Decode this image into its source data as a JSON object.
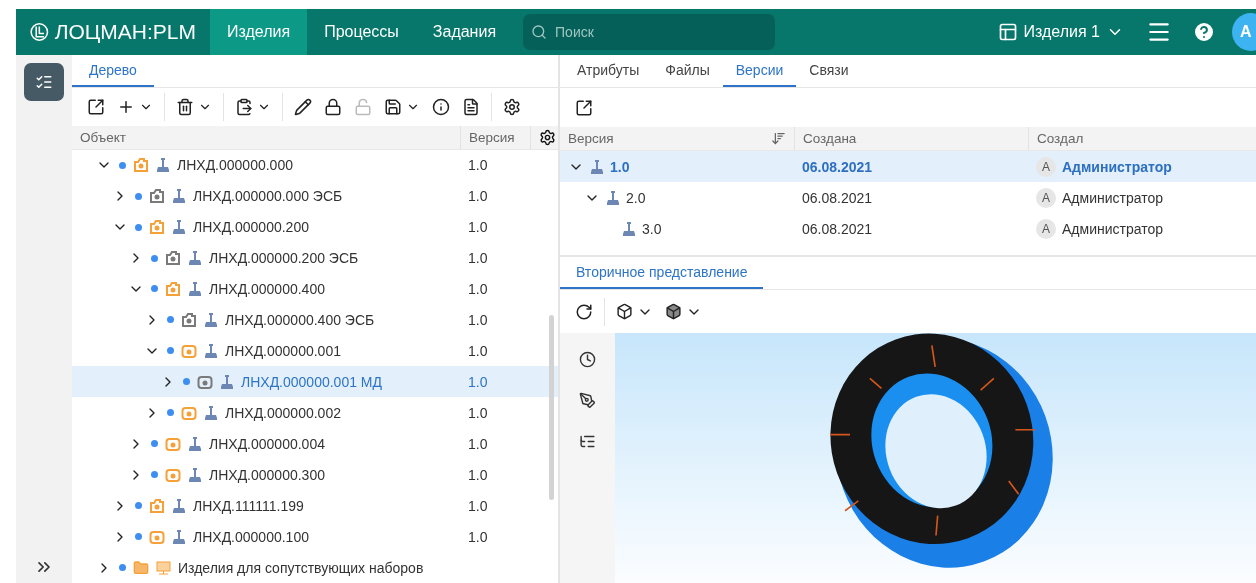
{
  "header": {
    "logo": "ЛОЦМАН:PLM",
    "nav": [
      {
        "label": "Изделия",
        "selected": true
      },
      {
        "label": "Процессы",
        "selected": false
      },
      {
        "label": "Задания",
        "selected": false
      }
    ],
    "search": {
      "placeholder": "Поиск"
    },
    "workspace": "Изделия 1",
    "avatar": "А"
  },
  "left_panel": {
    "tabs": [
      {
        "label": "Дерево",
        "selected": true
      }
    ],
    "toolbar": [
      {
        "kind": "export",
        "disabled": false,
        "menu": false
      },
      {
        "kind": "add",
        "disabled": false,
        "menu": true
      },
      {
        "kind": "divider"
      },
      {
        "kind": "delete",
        "disabled": false,
        "menu": true
      },
      {
        "kind": "divider"
      },
      {
        "kind": "paste",
        "disabled": false,
        "menu": true
      },
      {
        "kind": "divider"
      },
      {
        "kind": "edit",
        "disabled": false,
        "menu": false
      },
      {
        "kind": "lock",
        "disabled": false,
        "menu": false
      },
      {
        "kind": "unlock",
        "disabled": true,
        "menu": false
      },
      {
        "kind": "save",
        "disabled": false,
        "menu": true
      },
      {
        "kind": "info",
        "disabled": false,
        "menu": false
      },
      {
        "kind": "report",
        "disabled": false,
        "menu": false
      },
      {
        "kind": "divider"
      },
      {
        "kind": "settings",
        "disabled": false,
        "menu": false
      }
    ],
    "columns": [
      "Объект",
      "Версия"
    ],
    "rows": [
      {
        "label": "ЛНХД.000000.000",
        "version": "1.0",
        "kind": "assembly",
        "expanded": true,
        "selected": false,
        "children": [
          {
            "label": "ЛНХД.000000.000 ЭСБ",
            "version": "1.0",
            "kind": "esb",
            "expanded": false,
            "selected": false
          },
          {
            "label": "ЛНХД.000000.200",
            "version": "1.0",
            "kind": "assembly",
            "expanded": true,
            "selected": false,
            "children": [
              {
                "label": "ЛНХД.000000.200 ЭСБ",
                "version": "1.0",
                "kind": "esb",
                "expanded": false,
                "selected": false
              },
              {
                "label": "ЛНХД.000000.400",
                "version": "1.0",
                "kind": "assembly",
                "expanded": true,
                "selected": false,
                "children": [
                  {
                    "label": "ЛНХД.000000.400 ЭСБ",
                    "version": "1.0",
                    "kind": "esb",
                    "expanded": false,
                    "selected": false
                  },
                  {
                    "label": "ЛНХД.000000.001",
                    "version": "1.0",
                    "kind": "part",
                    "expanded": true,
                    "selected": false,
                    "children": [
                      {
                        "label": "ЛНХД.000000.001 МД",
                        "version": "1.0",
                        "kind": "model",
                        "expanded": false,
                        "selected": true
                      }
                    ]
                  },
                  {
                    "label": "ЛНХД.000000.002",
                    "version": "1.0",
                    "kind": "part",
                    "expanded": false,
                    "selected": false
                  }
                ]
              },
              {
                "label": "ЛНХД.000000.004",
                "version": "1.0",
                "kind": "part",
                "expanded": false,
                "selected": false
              },
              {
                "label": "ЛНХД.000000.300",
                "version": "1.0",
                "kind": "part",
                "expanded": false,
                "selected": false
              }
            ]
          },
          {
            "label": "ЛНХД.111111.199",
            "version": "1.0",
            "kind": "assembly",
            "expanded": false,
            "selected": false
          },
          {
            "label": "ЛНХД.000000.100",
            "version": "1.0",
            "kind": "part",
            "expanded": false,
            "selected": false
          }
        ]
      },
      {
        "label": "Изделия для сопутствующих наборов",
        "kind": "folder",
        "expanded": false,
        "selected": false
      }
    ]
  },
  "right_panel": {
    "tabs": [
      {
        "label": "Атрибуты",
        "selected": false
      },
      {
        "label": "Файлы",
        "selected": false
      },
      {
        "label": "Версии",
        "selected": true
      },
      {
        "label": "Связи",
        "selected": false
      }
    ],
    "columns": [
      "Версия",
      "Создана",
      "Создал"
    ],
    "rows": [
      {
        "version": "1.0",
        "created": "06.08.2021",
        "author": "Администратор",
        "avatar": "А",
        "expanded": true,
        "selected": true,
        "children": [
          {
            "version": "2.0",
            "created": "06.08.2021",
            "author": "Администратор",
            "avatar": "А",
            "expanded": true,
            "selected": false,
            "children": [
              {
                "version": "3.0",
                "created": "06.08.2021",
                "author": "Администратор",
                "avatar": "А",
                "selected": false
              }
            ]
          }
        ]
      }
    ],
    "secondary_tabs": [
      {
        "label": "Вторичное представление",
        "selected": true
      }
    ]
  }
}
